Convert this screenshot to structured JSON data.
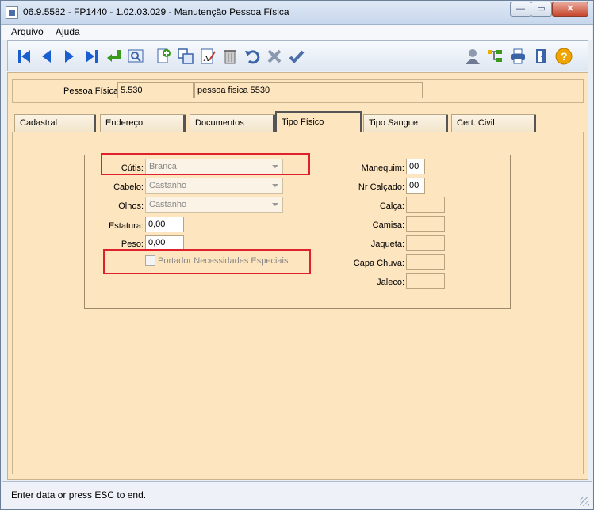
{
  "window": {
    "title": "06.9.5582 - FP1440 - 1.02.03.029 - Manutenção Pessoa Física"
  },
  "menu": {
    "items": [
      {
        "label": "Arquivo"
      },
      {
        "label": "Ajuda"
      }
    ]
  },
  "toolbar": {
    "icons": [
      "first-icon",
      "prev-icon",
      "next-icon",
      "last-icon",
      "goto-icon",
      "search-icon",
      "add-icon",
      "copy-icon",
      "edit-icon",
      "delete-icon",
      "undo-icon",
      "cancel-icon",
      "save-icon",
      "user-icon",
      "tree-icon",
      "print-icon",
      "exit-icon",
      "help-icon"
    ]
  },
  "header": {
    "pessoa_label": "Pessoa Física:",
    "pessoa_code": "5.530",
    "pessoa_name": "pessoa fisica 5530"
  },
  "tabs": [
    {
      "label": "Cadastral"
    },
    {
      "label": "Endereço"
    },
    {
      "label": "Documentos"
    },
    {
      "label": "Tipo Físico",
      "active": true
    },
    {
      "label": "Tipo Sangue"
    },
    {
      "label": "Cert. Civil"
    }
  ],
  "form": {
    "cutis": {
      "label": "Cútis:",
      "value": "Branca"
    },
    "cabelo": {
      "label": "Cabelo:",
      "value": "Castanho"
    },
    "olhos": {
      "label": "Olhos:",
      "value": "Castanho"
    },
    "estatura": {
      "label": "Estatura:",
      "value": "0,00"
    },
    "peso": {
      "label": "Peso:",
      "value": "0,00"
    },
    "necessidades": {
      "label": "Portador Necessidades Especiais",
      "checked": false
    },
    "manequim": {
      "label": "Manequim:",
      "value": "00"
    },
    "calcado": {
      "label": "Nr Calçado:",
      "value": "00"
    },
    "calca": {
      "label": "Calça:",
      "value": ""
    },
    "camisa": {
      "label": "Camisa:",
      "value": ""
    },
    "jaqueta": {
      "label": "Jaqueta:",
      "value": ""
    },
    "capa": {
      "label": "Capa Chuva:",
      "value": ""
    },
    "jaleco": {
      "label": "Jaleco:",
      "value": ""
    }
  },
  "status": {
    "message": "Enter data or press ESC to end."
  },
  "colors": {
    "panel_bg": "#fde5bf",
    "highlight": "#e0202a",
    "toolbar_blue": "#1a5fd0"
  }
}
